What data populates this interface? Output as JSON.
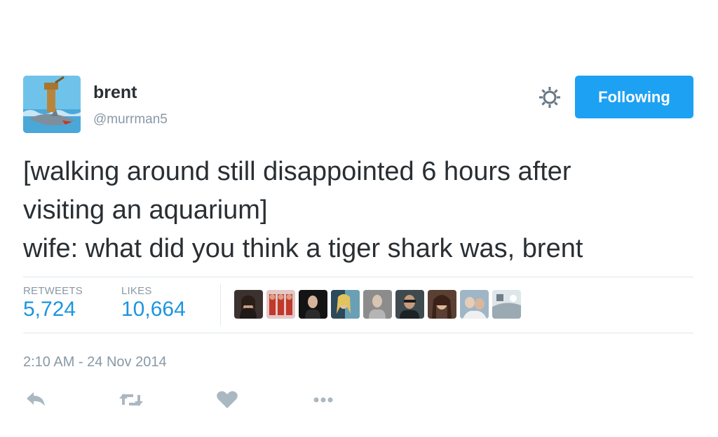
{
  "user": {
    "display_name": "brent",
    "handle": "@murrman5"
  },
  "follow_button": {
    "label": "Following",
    "color": "#1da1f2"
  },
  "tweet": {
    "lines": [
      "[walking around still disappointed 6 hours after",
      "visiting an aquarium]",
      "wife: what did you think a tiger shark was, brent"
    ]
  },
  "stats": {
    "retweets_label": "RETWEETS",
    "retweets_value": "5,724",
    "likes_label": "LIKES",
    "likes_value": "10,664",
    "value_color": "#1b95e0"
  },
  "likers": [
    "liker-avatar-1",
    "liker-avatar-2",
    "liker-avatar-3",
    "liker-avatar-4",
    "liker-avatar-5",
    "liker-avatar-6",
    "liker-avatar-7",
    "liker-avatar-8",
    "liker-avatar-9"
  ],
  "timestamp": "2:10 AM - 24 Nov 2014",
  "actions": {
    "icons": [
      "reply-icon",
      "retweet-icon",
      "like-icon",
      "more-icon"
    ]
  }
}
